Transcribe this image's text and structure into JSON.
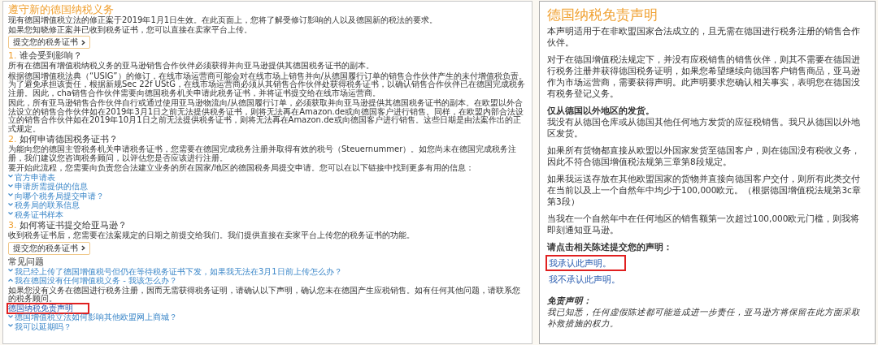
{
  "left_panel": {
    "title": "遵守新的德国纳税义务",
    "intro": {
      "paragraphs": [
        "现有德国增值税立法的修正案于2019年1月1日生效。在此页面上，您将了解受修订影响的人以及德国新的税法的要求。",
        "如果您知晓修正案并已收到税务证书，您可以直接在卖家平台上传。"
      ],
      "button": "提交您的税务证书"
    },
    "sections": [
      {
        "number": "1.",
        "heading": "谁会受到影响？",
        "paragraphs": [
          "所有在德国有增值税纳税义务的亚马逊销售合作伙伴必须获得并向亚马逊提供其德国税务证书的副本。",
          "根据德国增值税法典（“USIG”）的修订，在线市场运营商可能会对在线市场上销售并向/从德国履行订单的销售合作伙伴产生的未付增值税负责。为了避免承担该责任，根据新规Sec 22f UStG，在线市场运营商必须从其销售合作伙伴处获得税务证书，以确认销售合作伙伴已在德国完成税务注册。因此，cha销售合作伙伴需要向德国税务机关申请此税务证书，并将证书提交给在线市场运营商。",
          "因此，所有亚马逊销售合作伙伴自行或通过使用亚马逊物流向/从德国履行订单，必须获取并向亚马逊提供其德国税务证书的副本。在欧盟以外合法设立的销售合作伙伴如在2019年3月1日之前无法提供税务证书，则将无法再在Amazon.de或向德国客户进行销售。同样，在欧盟内部合法设立的销售合作伙伴如在2019年10月1日之前无法提供税务证书，则将无法再在Amazon.de或向德国客户进行销售。这些日期是由法案作出的正式规定。"
        ]
      },
      {
        "number": "2.",
        "heading": "如何申请德国税务证书？",
        "paragraphs": [
          "为能向您的德国主管税务机关申请税务证书，您需要在德国完成税务注册并取得有效的税号（Steuernummer）。如您尚未在德国完成税务注册，我们建议您咨询税务顾问，以评估您是否应该进行注册。",
          "要开始此流程，您需要向负责您合法建立业务的所在国家/地区的德国税务局提交申请。您可以在以下链接中找到更多有用的信息："
        ],
        "links": [
          "官方申请表",
          "申请所需提供的信息",
          "向哪个税务局提交申请？",
          "税务局的联系信息",
          "税务证书样本"
        ]
      },
      {
        "number": "3.",
        "heading": "如何将证书提交给亚马逊？",
        "paragraphs": [
          "收到税务证书后，您需要在法案规定的日期之前提交给我们。我们提供直接在卖家平台上传您的税务证书的功能。"
        ],
        "button": "提交您的税务证书"
      }
    ],
    "faq": {
      "heading": "常见问题",
      "items": [
        {
          "question": "我已经上传了德国增值税号但仍在等待税务证书下发，如果我无法在3月1日前上传怎么办？",
          "expanded": false
        },
        {
          "question": "我在德国没有任何增值税义务 - 我该怎么办？",
          "expanded": true,
          "answer": "如果您没有义务在德国进行税务注册，因而无需获得税务证明，请确认以下声明，确认您未在德国产生应税销售。如有任何其他问题，请联系您的税务顾问。",
          "link": "德国纳税免责声明",
          "highlighted": true
        },
        {
          "question": "德国增值税立法如何影响其他欧盟网上商城？",
          "expanded": false
        },
        {
          "question": "我可以延期吗？",
          "expanded": false
        }
      ]
    }
  },
  "right_panel": {
    "title": "德国纳税免责声明",
    "blocks": [
      {
        "kind": "text",
        "text": "本声明适用于在非欧盟国家合法成立的，且无需在德国进行税务注册的销售合作伙伴。"
      },
      {
        "kind": "text",
        "text": "对于在德国增值税法规定下，并没有应税销售的销售伙伴，则其不需要在德国进行税务注册并获得德国税务证明，如果您希望继续向德国客户销售商品，亚马逊作为市场运营商，需要获得声明。此声明要求您确认相关事实，表明您在德国没有税务登记义务。"
      },
      {
        "kind": "heading",
        "text": "仅从德国以外地区的发货。"
      },
      {
        "kind": "text",
        "text": "我没有从德国仓库或从德国其他任何地方发货的应征税销售。我只从德国以外地区发货。"
      },
      {
        "kind": "text",
        "text": "如果所有货物都直接从欧盟以外国家发货至德国客户，则在德国没有税收义务，因此不符合德国增值税法规第三章第8段规定。"
      },
      {
        "kind": "text",
        "text": "如果我运送存放在其他欧盟国家的货物并直接向德国客户交付，则所有此类交付在当前以及上一个自然年中均少于100,000欧元。（根据德国增值税法规第3c章第3段）"
      },
      {
        "kind": "text",
        "text": "当我在一个自然年中在任何地区的销售额第一次超过100,000欧元门槛，则我将即刻通知亚马逊。"
      },
      {
        "kind": "heading",
        "text": "请点击相关陈述提交您的声明："
      }
    ],
    "links": [
      {
        "text": "我承认此声明。",
        "highlighted": true
      },
      {
        "text": "我不承认此声明。",
        "highlighted": false
      }
    ],
    "disclaimer": {
      "title": "免责声明：",
      "text": "我已知悉，任何虚假陈述都可能造成进一步责任，亚马逊方将保留在此方面采取补救措施的权力。"
    }
  }
}
